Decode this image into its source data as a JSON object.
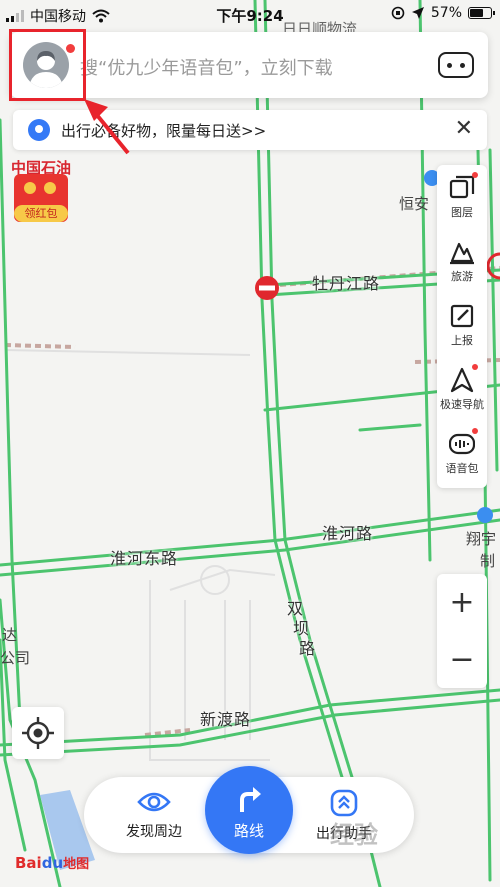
{
  "status_bar": {
    "carrier": "中国移动",
    "time": "下午9:24",
    "battery": "57%",
    "battery_level": 0.57
  },
  "search": {
    "placeholder": "搜“优九少年语音包”，立刻下载"
  },
  "promo": {
    "text": "出行必备好物，限量每日送>>",
    "close_label": "✕"
  },
  "red_packet": {
    "label": "领红包"
  },
  "map": {
    "poi_sinopec": "中国石油",
    "poi_top": "日日顺物流",
    "poi_hengan": "恒安",
    "poi_xiangyu_1": "翔宇",
    "poi_xiangyu_2": "制",
    "poi_left_1": "达",
    "poi_left_2": "公司",
    "roads": {
      "mudanjiang": "牡丹江路",
      "huaihe_east": "淮河东路",
      "huaihe": "淮河路",
      "shuangba_1": "双",
      "shuangba_2": "坝",
      "shuangba_3": "路",
      "xindu": "新渡路"
    }
  },
  "toolbar": {
    "items": [
      {
        "label": "图层",
        "icon": "layers-icon",
        "dot": true
      },
      {
        "label": "旅游",
        "icon": "travel-icon",
        "dot": false
      },
      {
        "label": "上报",
        "icon": "report-icon",
        "dot": false
      },
      {
        "label": "极速导航",
        "icon": "navigation-icon",
        "dot": true
      },
      {
        "label": "语音包",
        "icon": "voice-pack-icon",
        "dot": true
      }
    ]
  },
  "zoom": {
    "in_label": "+",
    "out_label": "−"
  },
  "bottom_nav": {
    "discover_label": "发现周边",
    "route_label": "路线",
    "assistant_label": "出行助手"
  },
  "logo": {
    "bai": "Bai",
    "du": "du",
    "tu": "地图"
  },
  "watermark": "经验",
  "colors": {
    "road_green": "#4cc46e",
    "accent_blue": "#3477f5",
    "highlight_red": "#e8242c",
    "notification_red": "#f23d3d"
  }
}
